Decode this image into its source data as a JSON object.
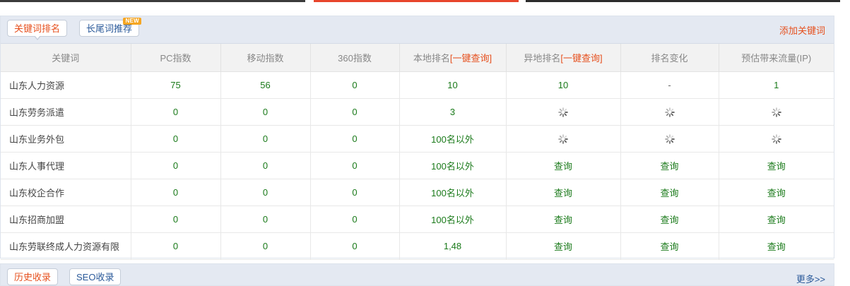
{
  "tabs": {
    "keyword_rank": "关键词排名",
    "longtail": "长尾词推荐",
    "new_badge": "NEW"
  },
  "actions": {
    "add_keyword": "添加关键词",
    "more": "更多>>"
  },
  "columns": {
    "keyword": "关键词",
    "pc": "PC指数",
    "mobile": "移动指数",
    "s360": "360指数",
    "local_rank": "本地排名",
    "remote_rank": "异地排名",
    "one_click_query": "[一键查询]",
    "rank_change": "排名变化",
    "traffic": "预估带来流量(IP)"
  },
  "rows": [
    {
      "keyword": "山东人力资源",
      "pc": "75",
      "mobile": "56",
      "s360": "0",
      "local": "10",
      "remote": "10",
      "change": "-",
      "traffic": "1"
    },
    {
      "keyword": "山东劳务派遣",
      "pc": "0",
      "mobile": "0",
      "s360": "0",
      "local": "3",
      "remote": "loading",
      "change": "loading",
      "traffic": "loading"
    },
    {
      "keyword": "山东业务外包",
      "pc": "0",
      "mobile": "0",
      "s360": "0",
      "local": "100名以外",
      "remote": "loading",
      "change": "loading",
      "traffic": "loading"
    },
    {
      "keyword": "山东人事代理",
      "pc": "0",
      "mobile": "0",
      "s360": "0",
      "local": "100名以外",
      "remote": "查询",
      "change": "查询",
      "traffic": "查询"
    },
    {
      "keyword": "山东校企合作",
      "pc": "0",
      "mobile": "0",
      "s360": "0",
      "local": "100名以外",
      "remote": "查询",
      "change": "查询",
      "traffic": "查询"
    },
    {
      "keyword": "山东招商加盟",
      "pc": "0",
      "mobile": "0",
      "s360": "0",
      "local": "100名以外",
      "remote": "查询",
      "change": "查询",
      "traffic": "查询"
    },
    {
      "keyword": "山东劳联终成人力资源有限",
      "pc": "0",
      "mobile": "0",
      "s360": "0",
      "local": "1,48",
      "remote": "查询",
      "change": "查询",
      "traffic": "查询"
    }
  ],
  "footer_tabs": {
    "history": "历史收录",
    "seo": "SEO收录"
  },
  "colors": {
    "accent_orange": "#e6501e",
    "value_green": "#1a7a1a",
    "link_blue": "#2b5a9a",
    "header_bg": "#e4e9f2"
  },
  "icons": {
    "loading": "loading-spinner-icon"
  }
}
